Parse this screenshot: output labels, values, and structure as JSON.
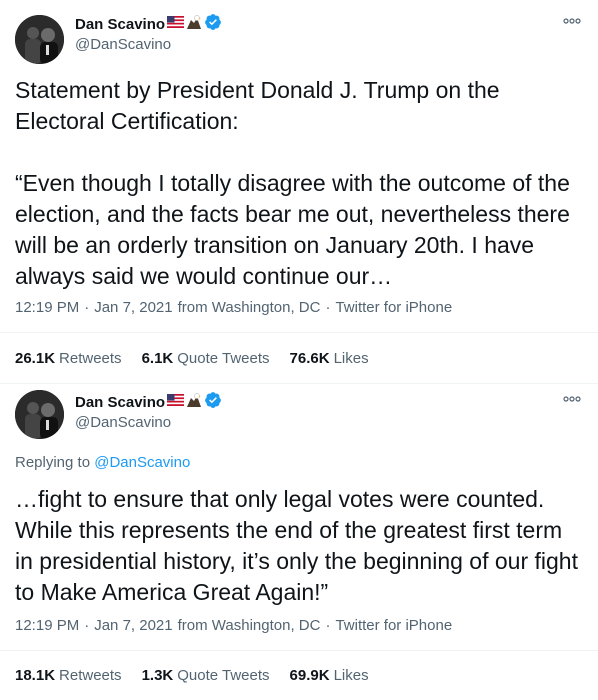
{
  "tweets": [
    {
      "author": {
        "name": "Dan Scavino",
        "handle": "@DanScavino",
        "verified": true,
        "name_emojis": [
          "us-flag-emoji",
          "eagle-emoji"
        ]
      },
      "replying_to": null,
      "text": "Statement by President Donald J. Trump on the Electoral Certification:\n\n“Even though I totally disagree with the outcome of the election, and the facts bear me out, nevertheless there will be an orderly transition on January 20th. I have always said we would continue our…",
      "time": "12:19 PM",
      "date": "Jan 7, 2021",
      "location": "from Washington, DC",
      "client": "Twitter for iPhone",
      "stats": {
        "retweets": {
          "count": "26.1K",
          "label": "Retweets"
        },
        "quotes": {
          "count": "6.1K",
          "label": "Quote Tweets"
        },
        "likes": {
          "count": "76.6K",
          "label": "Likes"
        }
      }
    },
    {
      "author": {
        "name": "Dan Scavino",
        "handle": "@DanScavino",
        "verified": true,
        "name_emojis": [
          "us-flag-emoji",
          "eagle-emoji"
        ]
      },
      "replying_to": {
        "prefix": "Replying to",
        "handle": "@DanScavino"
      },
      "text": "…fight to ensure that only legal votes were counted. While this represents the end of the greatest first term in presidential history, it’s only the beginning of our fight to Make America Great Again!”",
      "time": "12:19 PM",
      "date": "Jan 7, 2021",
      "location": "from Washington, DC",
      "client": "Twitter for iPhone",
      "stats": {
        "retweets": {
          "count": "18.1K",
          "label": "Retweets"
        },
        "quotes": {
          "count": "1.3K",
          "label": "Quote Tweets"
        },
        "likes": {
          "count": "69.9K",
          "label": "Likes"
        }
      }
    }
  ],
  "meta_separator": "·",
  "colors": {
    "primary_text": "#0f1419",
    "secondary_text": "#536471",
    "link": "#1d9bf0",
    "verified": "#1d9bf0",
    "divider": "#eff3f4"
  },
  "icons": {
    "more": "more-dots-icon",
    "verified": "verified-badge-icon"
  }
}
